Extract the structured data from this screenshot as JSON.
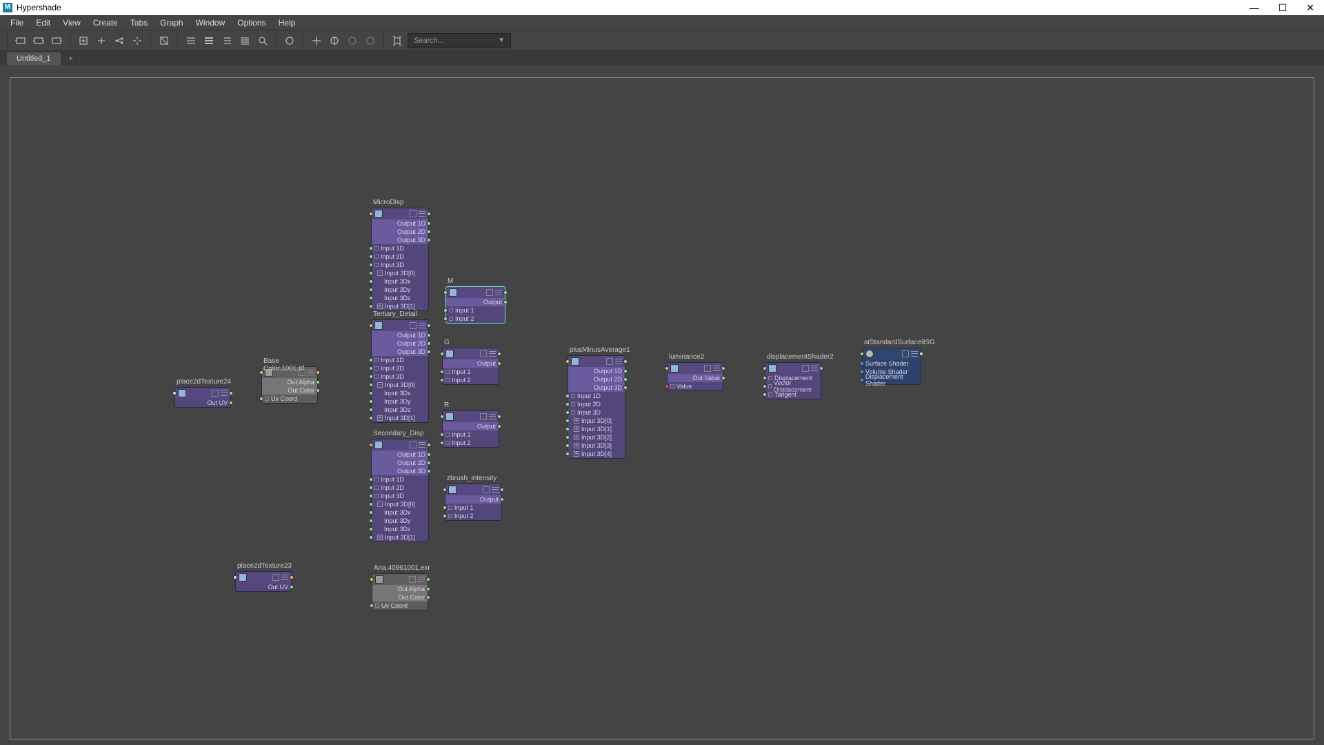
{
  "title": "Hypershade",
  "menu": [
    "File",
    "Edit",
    "View",
    "Create",
    "Tabs",
    "Graph",
    "Window",
    "Options",
    "Help"
  ],
  "search_placeholder": "Search...",
  "tab": "Untitled_1",
  "labels": {
    "outUV": "Out UV",
    "outAlpha": "Out Alpha",
    "outColor": "Out Color",
    "uvCoord": "Uv Coord",
    "out1D": "Output 1D",
    "out2D": "Output 2D",
    "out3D": "Output 3D",
    "in1D": "Input 1D",
    "in2D": "Input 2D",
    "in3D": "Input 3D",
    "in3D0": "Input 3D[0]",
    "in3Dx": "Input 3Dx",
    "in3Dy": "Input 3Dy",
    "in3Dz": "Input 3Dz",
    "in3D1": "Input 3D[1]",
    "in3D2": "Input 3D[2]",
    "in3D3": "Input 3D[3]",
    "in3D4": "Input 3D[4]",
    "out": "Output",
    "in1": "Input 1",
    "in2": "Input 2",
    "outVal": "Out Value",
    "val": "Value",
    "disp": "Displacement",
    "vdisp": "Vector Displacement",
    "tang": "Tangent",
    "ss": "Surface Shader",
    "vs": "Volume Shader",
    "ds": "Displacement Shader"
  },
  "nodes": {
    "p2d24": "place2dTexture24",
    "p2d23": "place2dTexture23",
    "base": "Base Color.1001.tif",
    "ana": "Ana.40961001.exr",
    "micro": "MicroDisp",
    "tert": "Tertiary_Detail",
    "sec": "Secondary_Disp",
    "m": "M",
    "g": "G",
    "r": "R",
    "zb": "zbrush_intensity",
    "pma": "plusMinusAverage1",
    "lum": "luminance2",
    "dsh": "displacementShader2",
    "sg": "aiStandardSurface9SG"
  }
}
